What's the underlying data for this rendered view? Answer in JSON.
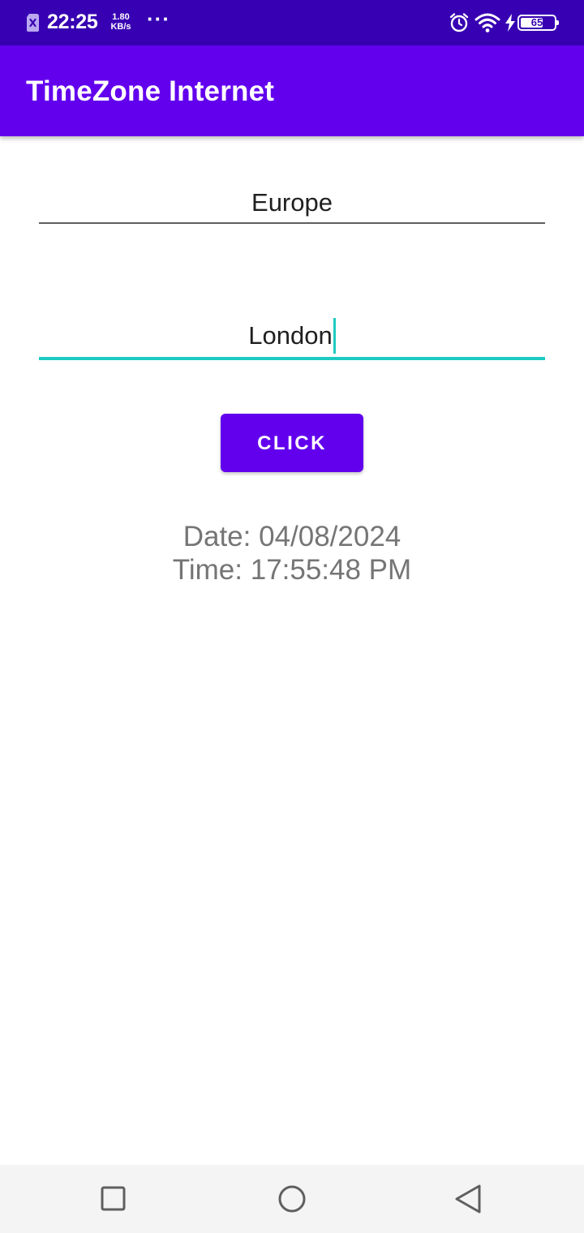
{
  "status_bar": {
    "time": "22:25",
    "net_speed_value": "1.80",
    "net_speed_unit": "KB/s",
    "more_indicator": "···",
    "battery_level": "65",
    "icons": [
      "sim-off-icon",
      "alarm-icon",
      "wifi-icon",
      "charging-bolt-icon",
      "battery-icon"
    ]
  },
  "app_bar": {
    "title": "TimeZone Internet",
    "color": "#6200ee"
  },
  "form": {
    "region_value": "Europe",
    "city_value": "London",
    "button_label": "CLICK",
    "accent_color": "#1ecbc0"
  },
  "result": {
    "date_line": "Date: 04/08/2024",
    "time_line": "Time: 17:55:48 PM"
  },
  "nav_bar": {
    "icons": [
      "recent-apps-icon",
      "home-icon",
      "back-icon"
    ]
  }
}
